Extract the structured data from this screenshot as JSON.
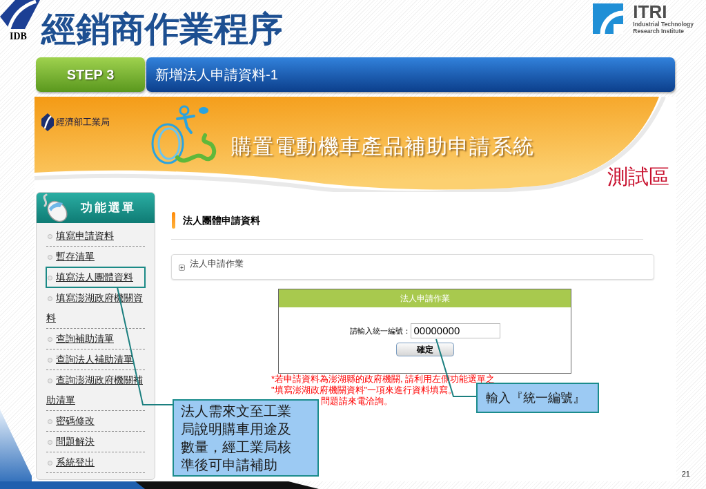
{
  "slide": {
    "logo_text": "IDB",
    "title": "經銷商作業程序",
    "partner_logo": {
      "name": "ITRI",
      "lines": [
        "Industrial Technology",
        "Research Institute"
      ]
    },
    "page_number": "21"
  },
  "step": {
    "label": "STEP 3",
    "title": "新增法人申請資料-1"
  },
  "screenshot": {
    "banner": {
      "agency": "經濟部工業局",
      "system_title": "購置電動機車產品補助申請系統",
      "environment_label": "測試區"
    },
    "sidebar": {
      "title": "功能選單",
      "items": [
        {
          "label": "填寫申請資料",
          "highlighted": false
        },
        {
          "label": "暫存清單",
          "highlighted": false
        },
        {
          "label": "填寫法人團體資料",
          "highlighted": true
        },
        {
          "label": "填寫澎湖政府機關資料",
          "highlighted": false
        },
        {
          "label": "查詢補助清單",
          "highlighted": false
        },
        {
          "label": "查詢法人補助清單",
          "highlighted": false
        },
        {
          "label": "查詢澎湖政府機關補助清單",
          "highlighted": false
        },
        {
          "label": "密碼修改",
          "highlighted": false
        },
        {
          "label": "問題解決",
          "highlighted": false
        },
        {
          "label": "系統登出",
          "highlighted": false
        }
      ]
    },
    "section_title": "法人團體申請資料",
    "accordion": {
      "label": "法人申請作業"
    },
    "form": {
      "title": "法人申請作業",
      "field_label": "請輸入統一編號：",
      "field_value": "00000000",
      "button": "確定"
    },
    "note_lines": [
      "*若申請資料為澎湖縣的政府機關, 請利用左側功能選單之",
      "\"填寫澎湖政府機關資料\"一項來進行資料填寫。",
      "問題請來電洽詢。"
    ]
  },
  "callouts": [
    {
      "text": "法人需來文至工業局說明購車用途及數量，經工業局核準後可申請補助"
    },
    {
      "text": "輸入『統一編號』"
    }
  ]
}
